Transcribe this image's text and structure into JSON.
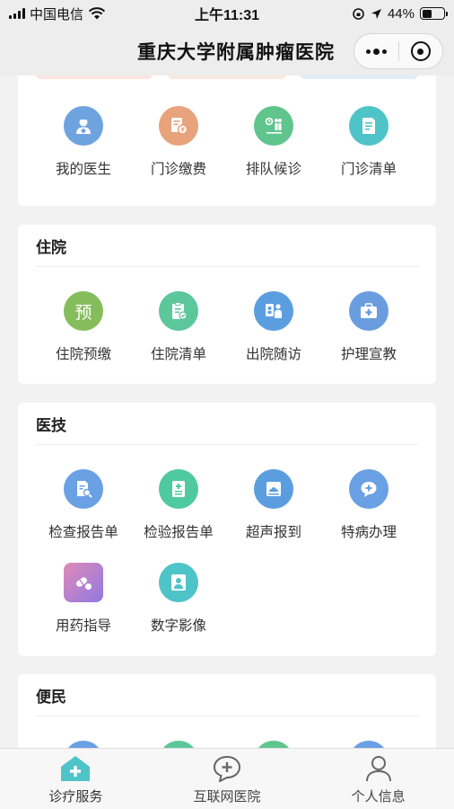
{
  "status_bar": {
    "carrier": "中国电信",
    "time": "上午11:31",
    "battery": "44%",
    "battery_level": 0.44
  },
  "header": {
    "title": "重庆大学附属肿瘤医院"
  },
  "sections": {
    "outpatient": {
      "items": [
        {
          "label": "我的医生",
          "icon": "doctor-icon",
          "color": "#6fa3e0"
        },
        {
          "label": "门诊缴费",
          "icon": "payment-icon",
          "color": "#e8a27c"
        },
        {
          "label": "排队候诊",
          "icon": "queue-icon",
          "color": "#5fc58d"
        },
        {
          "label": "门诊清单",
          "icon": "list-icon",
          "color": "#4fc4c8"
        }
      ]
    },
    "inpatient": {
      "title": "住院",
      "items": [
        {
          "label": "住院预缴",
          "icon": "prepay-icon",
          "glyph": "预",
          "color": "#86bd5c"
        },
        {
          "label": "住院清单",
          "icon": "checklist-icon",
          "color": "#5cc79a"
        },
        {
          "label": "出院随访",
          "icon": "followup-icon",
          "color": "#5b9ee0"
        },
        {
          "label": "护理宣教",
          "icon": "medkit-icon",
          "color": "#6a9de0"
        }
      ]
    },
    "medtech": {
      "title": "医技",
      "items": [
        {
          "label": "检查报告单",
          "icon": "exam-report-icon",
          "color": "#6aa0e4"
        },
        {
          "label": "检验报告单",
          "icon": "lab-report-icon",
          "color": "#4fcaa0"
        },
        {
          "label": "超声报到",
          "icon": "ultrasound-icon",
          "color": "#5b9ee0"
        },
        {
          "label": "特病办理",
          "icon": "chat-plus-icon",
          "color": "#6aa0e4"
        },
        {
          "label": "用药指导",
          "icon": "pill-icon",
          "color": "#b07fd8"
        },
        {
          "label": "数字影像",
          "icon": "imaging-icon",
          "color": "#4fc4c8"
        }
      ]
    },
    "convenience": {
      "title": "便民"
    }
  },
  "tabbar": {
    "tabs": [
      {
        "label": "诊疗服务",
        "icon": "medical-service-icon",
        "active": true
      },
      {
        "label": "互联网医院",
        "icon": "online-hospital-icon",
        "active": false
      },
      {
        "label": "个人信息",
        "icon": "profile-icon",
        "active": false
      }
    ]
  }
}
